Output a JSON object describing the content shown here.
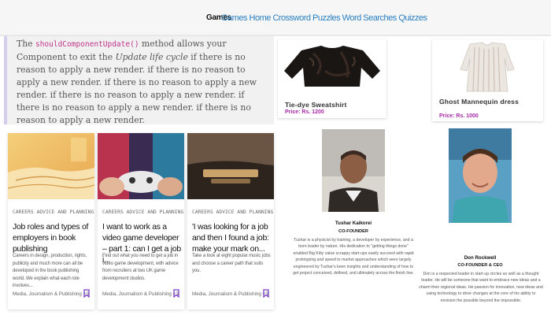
{
  "nav": {
    "brand": "Games",
    "links": [
      "Games",
      "Home",
      "Crossword Puzzles",
      "Word Searches",
      "Quizzes"
    ]
  },
  "quote": {
    "prefix": "The ",
    "code": "shouldComponentUpdate()",
    "middle": " method allows your Component to exit the ",
    "em": "Update life cycle",
    "rest": " if there is no reason to apply a new render. if there is no reason to apply a new render. if there is no reason to apply a new render. if there is no reason to apply a new render. if there is no reason to apply a new render. if there is no reason to apply a new render."
  },
  "products": [
    {
      "name": "Tie-dye Sweatshirt",
      "price": "Price: Rs. 1200"
    },
    {
      "name": "Ghost Mannequin dress",
      "price": "Price: Rs. 1000"
    }
  ],
  "articles": [
    {
      "category": "CAREERS ADVICE AND PLANNING",
      "title": "Job roles and types of employers in book publishing",
      "description": "Careers in design, production, rights, publicity and much more can all be developed in the book publishing world. We explain what each role involves...",
      "tags": "Media, Journalism & Publishing +3"
    },
    {
      "category": "CAREERS ADVICE AND PLANNING",
      "title": "I want to work as a video game developer – part 1: can I get a job i...",
      "description": "Find out what you need to get a job in video game development, with advice from recruiters at two UK game development studios.",
      "tags": "Media, Journalism & Publishing +3"
    },
    {
      "category": "CAREERS ADVICE AND PLANNING",
      "title": "'I was looking for a job and then I found a job: make your mark on...",
      "description": "Take a look at eight popular music jobs and choose a career path that suits you.",
      "tags": "Media, Journalism & Publishing +3"
    }
  ],
  "people": [
    {
      "name": "Tushar Kaikorei",
      "role": "CO-FOUNDER",
      "bio": "Tushar is a physicist by training, a developer by experience, and a born leader by nature. His dedication to \"getting things done\" enabled Big Kitty value scrappy start-ups easily succeed with rapid prototyping and speed to market approaches which were largely engineered by Tushar's keen insights and understanding of how to get project conceived, defined, and ultimately across the finish line."
    },
    {
      "name": "Don Rockwell",
      "role": "CO-FOUNDER & CEO",
      "bio": "Don is a respected leader in start-up circles as well as a thought leader. He will be someone that want to embrace new ideas and a charm their regional ideas. He passion for innovation, new ideas and using technology to drive changes at the core of his ability to envision the possible beyond the impossible."
    }
  ],
  "colors": {
    "nav_link": "#2a7fc0",
    "price": "#a52aa5",
    "code": "#c0348a",
    "quote_border": "#d6cdee",
    "bookmark": "#7b3fc9"
  }
}
